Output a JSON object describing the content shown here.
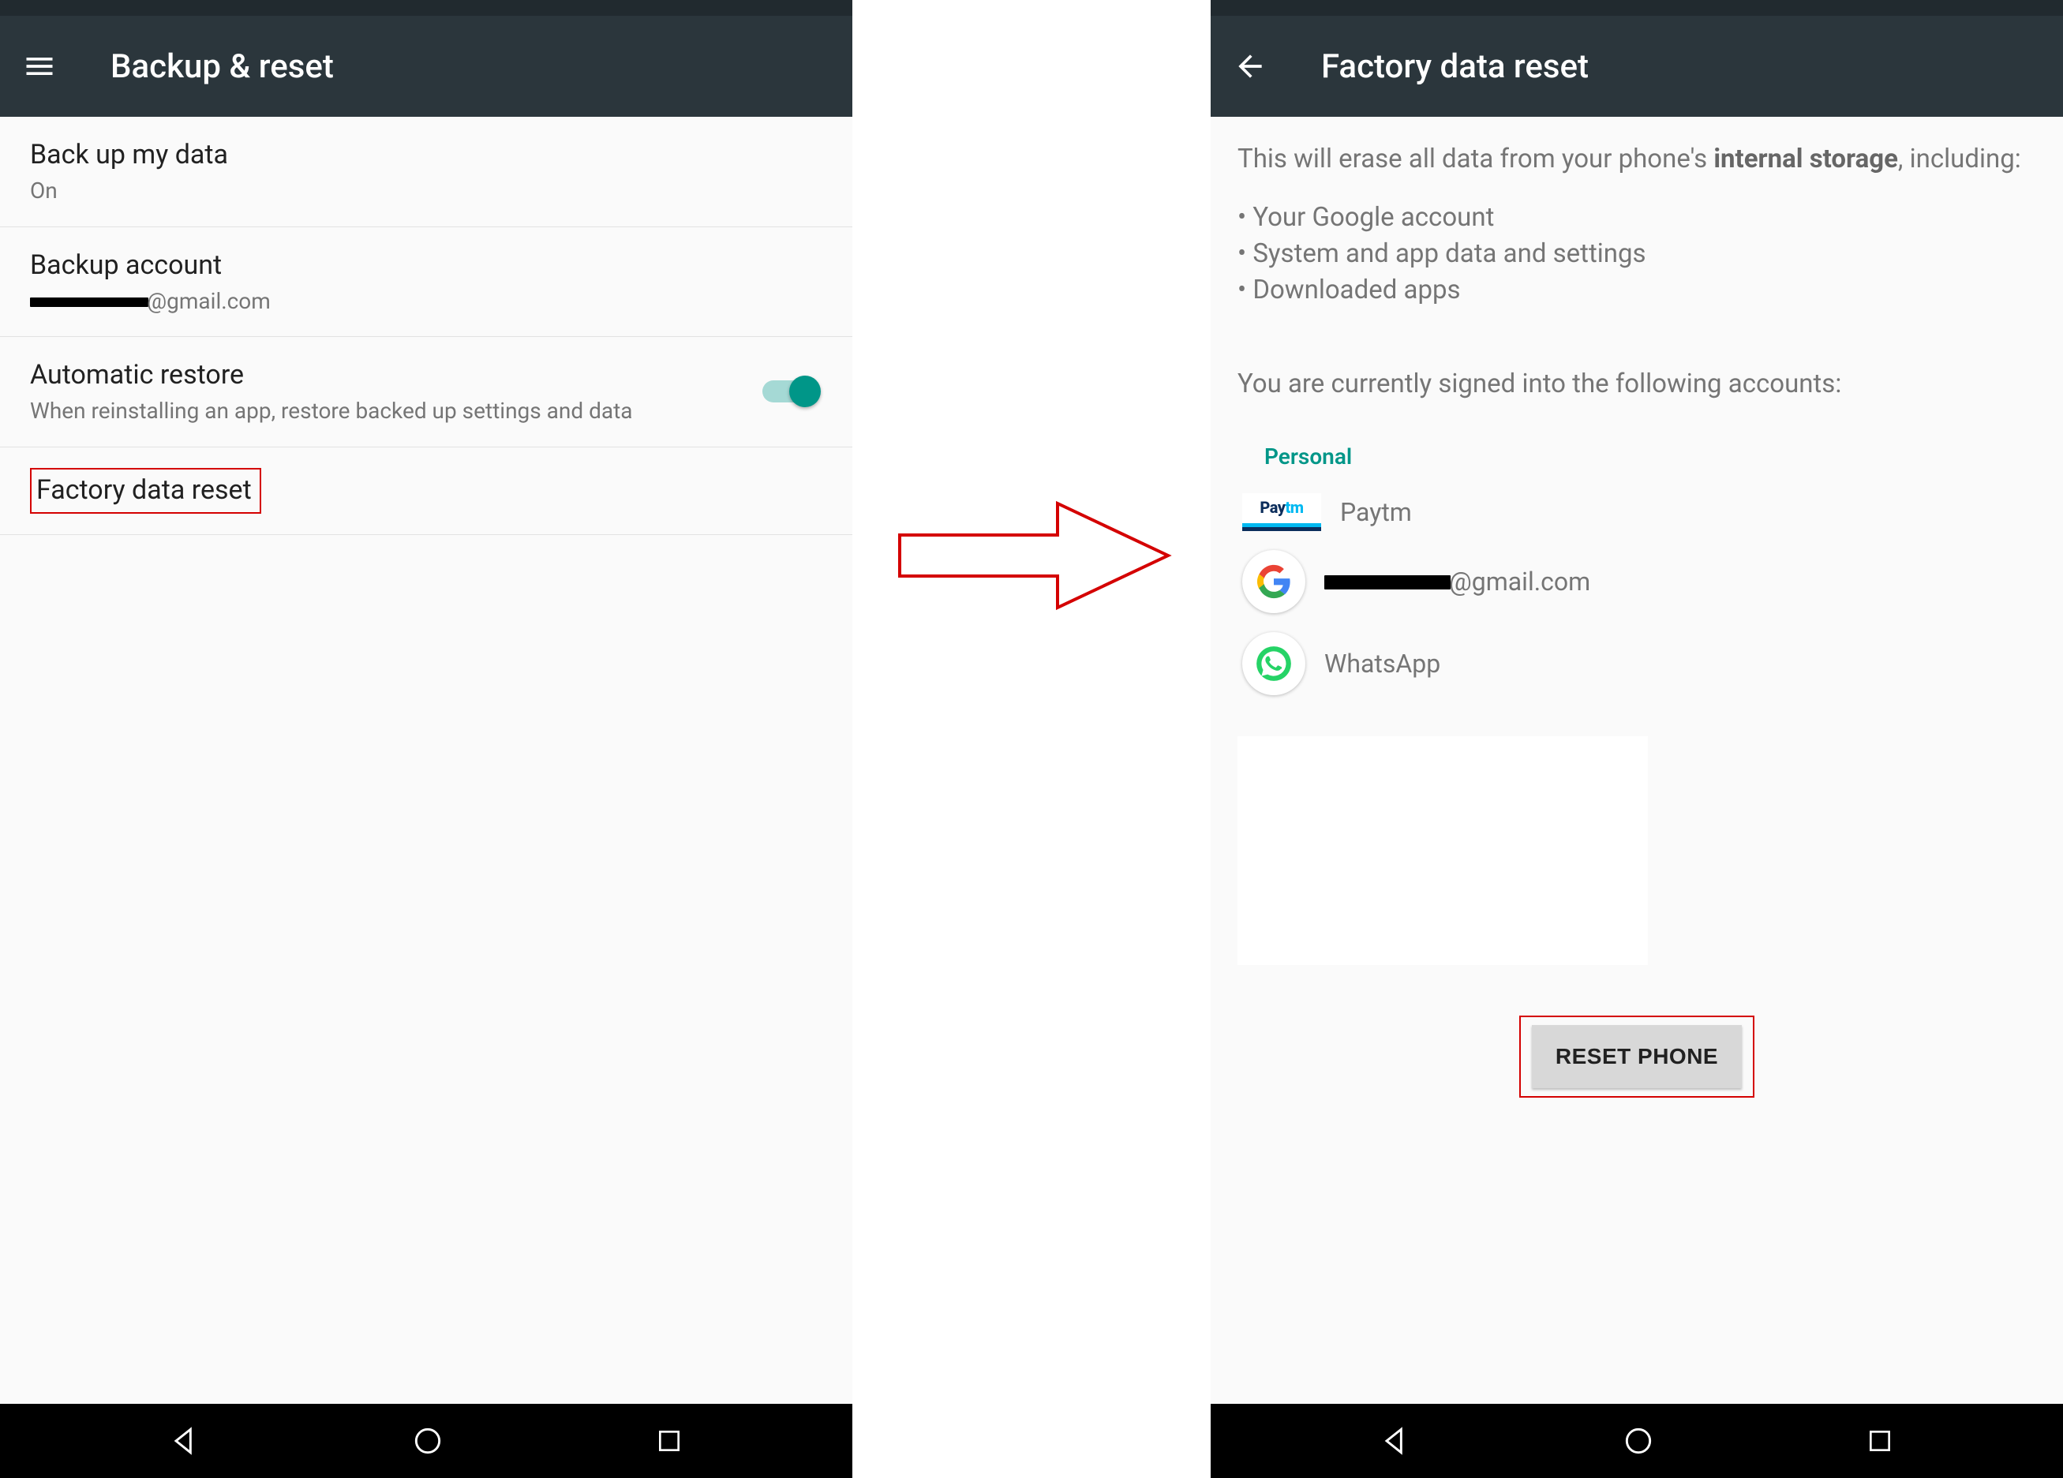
{
  "left": {
    "title": "Backup & reset",
    "items": {
      "backup_data": {
        "title": "Back up my data",
        "sub": "On"
      },
      "backup_account": {
        "title": "Backup account",
        "sub_suffix": "@gmail.com"
      },
      "auto_restore": {
        "title": "Automatic restore",
        "sub": "When reinstalling an app, restore backed up settings and data",
        "toggle_on": true
      },
      "factory_reset": {
        "title": "Factory data reset"
      }
    }
  },
  "right": {
    "title": "Factory data reset",
    "intro_prefix": "This will erase all data from your phone's ",
    "intro_bold": "internal storage",
    "intro_suffix": ", including:",
    "bullets": {
      "b1": "Your Google account",
      "b2": "System and app data and settings",
      "b3": "Downloaded apps"
    },
    "signed_in": "You are currently signed into the following accounts:",
    "section_personal": "Personal",
    "accounts": {
      "paytm": "Paytm",
      "google_suffix": "@gmail.com",
      "whatsapp": "WhatsApp"
    },
    "reset_button": "RESET PHONE"
  }
}
